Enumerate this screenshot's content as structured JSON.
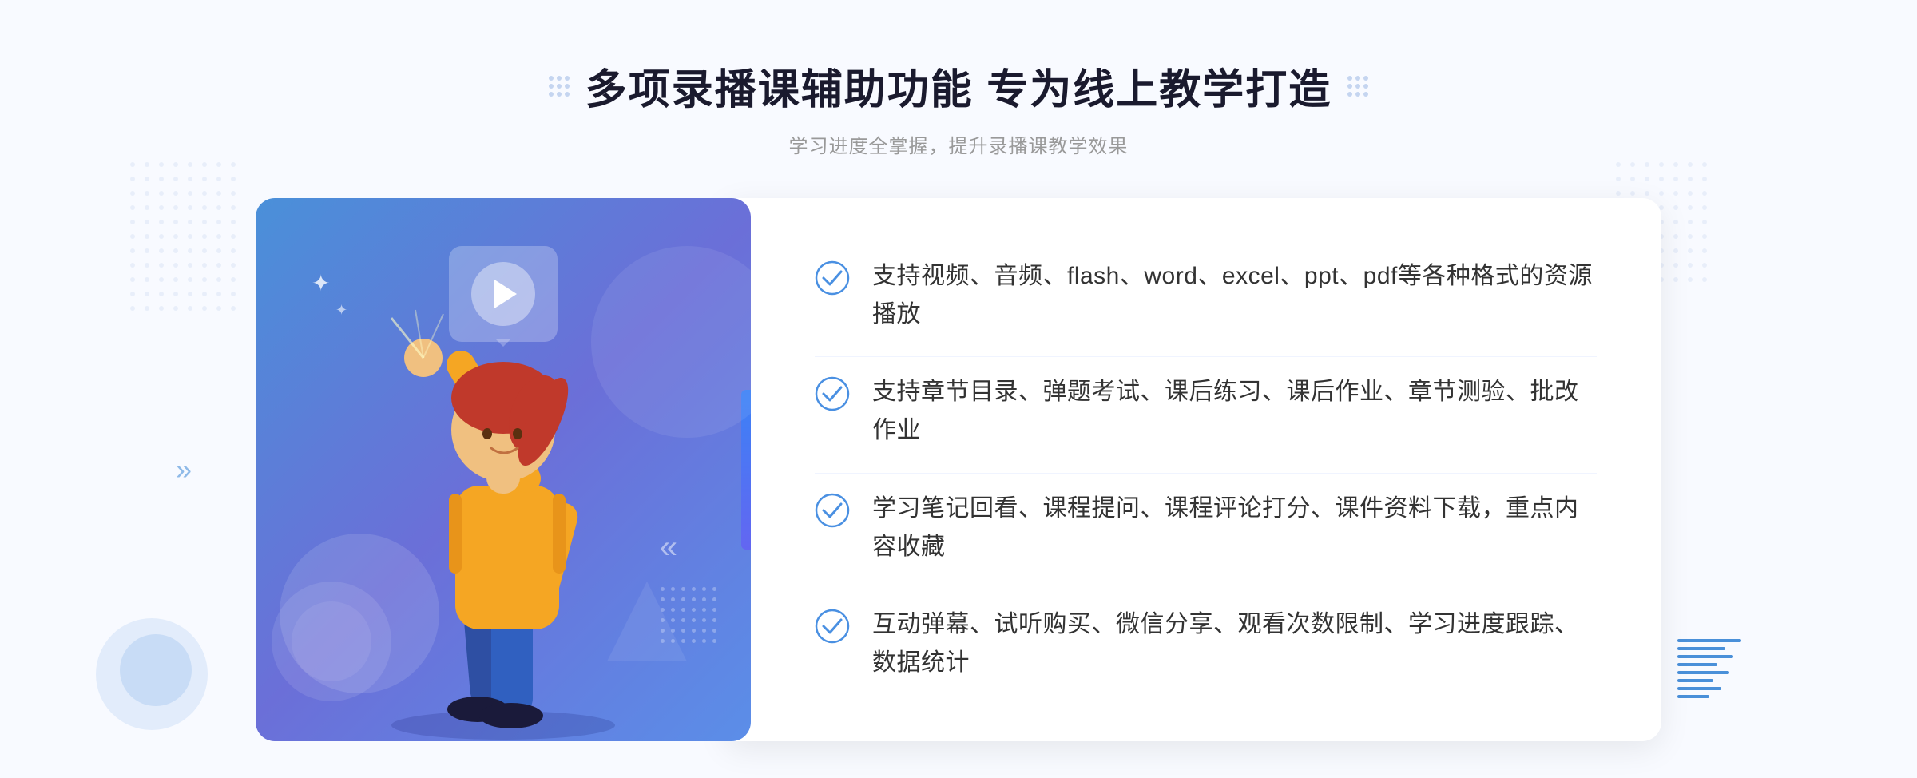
{
  "header": {
    "title": "多项录播课辅助功能 专为线上教学打造",
    "subtitle": "学习进度全掌握，提升录播课教学效果"
  },
  "features": [
    {
      "id": 1,
      "text": "支持视频、音频、flash、word、excel、ppt、pdf等各种格式的资源播放"
    },
    {
      "id": 2,
      "text": "支持章节目录、弹题考试、课后练习、课后作业、章节测验、批改作业"
    },
    {
      "id": 3,
      "text": "学习笔记回看、课程提问、课程评论打分、课件资料下载，重点内容收藏"
    },
    {
      "id": 4,
      "text": "互动弹幕、试听购买、微信分享、观看次数限制、学习进度跟踪、数据统计"
    }
  ],
  "decorations": {
    "arrow_left": "»",
    "play_label": "play-button"
  }
}
